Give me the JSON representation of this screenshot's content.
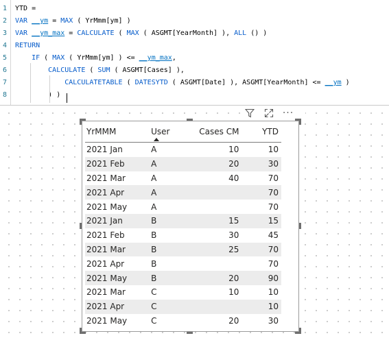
{
  "editor": {
    "lines": [
      {
        "num": "1",
        "parts": [
          {
            "t": "YTD =",
            "c": ""
          }
        ]
      },
      {
        "num": "2",
        "parts": [
          {
            "t": "VAR ",
            "c": "kw"
          },
          {
            "t": "__ym",
            "c": "var"
          },
          {
            "t": " = ",
            "c": ""
          },
          {
            "t": "MAX",
            "c": "fn"
          },
          {
            "t": " ( YrMmm[ym] )",
            "c": ""
          }
        ]
      },
      {
        "num": "3",
        "parts": [
          {
            "t": "VAR ",
            "c": "kw"
          },
          {
            "t": "__ym_max",
            "c": "var"
          },
          {
            "t": " = ",
            "c": ""
          },
          {
            "t": "CALCULATE",
            "c": "fn"
          },
          {
            "t": " ( ",
            "c": ""
          },
          {
            "t": "MAX",
            "c": "fn"
          },
          {
            "t": " ( ASGMT[YearMonth] ), ",
            "c": ""
          },
          {
            "t": "ALL",
            "c": "fn"
          },
          {
            "t": " () )",
            "c": ""
          }
        ]
      },
      {
        "num": "4",
        "parts": [
          {
            "t": "RETURN",
            "c": "kw"
          }
        ]
      },
      {
        "num": "5",
        "parts": [
          {
            "t": "    IF ",
            "c": "fn"
          },
          {
            "t": "( ",
            "c": ""
          },
          {
            "t": "MAX",
            "c": "fn"
          },
          {
            "t": " ( YrMmm[ym] ) <= ",
            "c": ""
          },
          {
            "t": "__ym_max",
            "c": "var"
          },
          {
            "t": ",",
            "c": ""
          }
        ]
      },
      {
        "num": "6",
        "parts": [
          {
            "t": "        CALCULATE",
            "c": "fn"
          },
          {
            "t": " ( ",
            "c": ""
          },
          {
            "t": "SUM",
            "c": "fn"
          },
          {
            "t": " ( ASGMT[Cases] ),",
            "c": ""
          }
        ]
      },
      {
        "num": "7",
        "parts": [
          {
            "t": "            CALCULATETABLE",
            "c": "fn"
          },
          {
            "t": " ( ",
            "c": ""
          },
          {
            "t": "DATESYTD",
            "c": "fn"
          },
          {
            "t": " ( ASGMT[Date] ), ASGMT[YearMonth] <= ",
            "c": ""
          },
          {
            "t": "__ym",
            "c": "var"
          },
          {
            "t": " )",
            "c": ""
          }
        ]
      },
      {
        "num": "8",
        "parts": [
          {
            "t": "        ) )",
            "c": ""
          }
        ]
      }
    ]
  },
  "visual_header": {
    "icons": [
      "filter-icon",
      "focus-mode-icon",
      "more-options-icon"
    ],
    "more_glyph": "···"
  },
  "table": {
    "columns": [
      {
        "label": "YrMMM",
        "align": "left"
      },
      {
        "label": "User",
        "align": "left"
      },
      {
        "label": "Cases CM",
        "align": "right"
      },
      {
        "label": "YTD",
        "align": "right"
      }
    ],
    "sort_column": "User",
    "rows": [
      [
        "2021 Jan",
        "A",
        "10",
        "10"
      ],
      [
        "2021 Feb",
        "A",
        "20",
        "30"
      ],
      [
        "2021 Mar",
        "A",
        "40",
        "70"
      ],
      [
        "2021 Apr",
        "A",
        "",
        "70"
      ],
      [
        "2021 May",
        "A",
        "",
        "70"
      ],
      [
        "2021 Jan",
        "B",
        "15",
        "15"
      ],
      [
        "2021 Feb",
        "B",
        "30",
        "45"
      ],
      [
        "2021 Mar",
        "B",
        "25",
        "70"
      ],
      [
        "2021 Apr",
        "B",
        "",
        "70"
      ],
      [
        "2021 May",
        "B",
        "20",
        "90"
      ],
      [
        "2021 Mar",
        "C",
        "10",
        "10"
      ],
      [
        "2021 Apr",
        "C",
        "",
        "10"
      ],
      [
        "2021 May",
        "C",
        "20",
        "30"
      ]
    ]
  },
  "colors": {
    "keyword": "#035aca",
    "variable": "#0070c1",
    "line_number": "#237893",
    "row_alt": "#ececec"
  }
}
